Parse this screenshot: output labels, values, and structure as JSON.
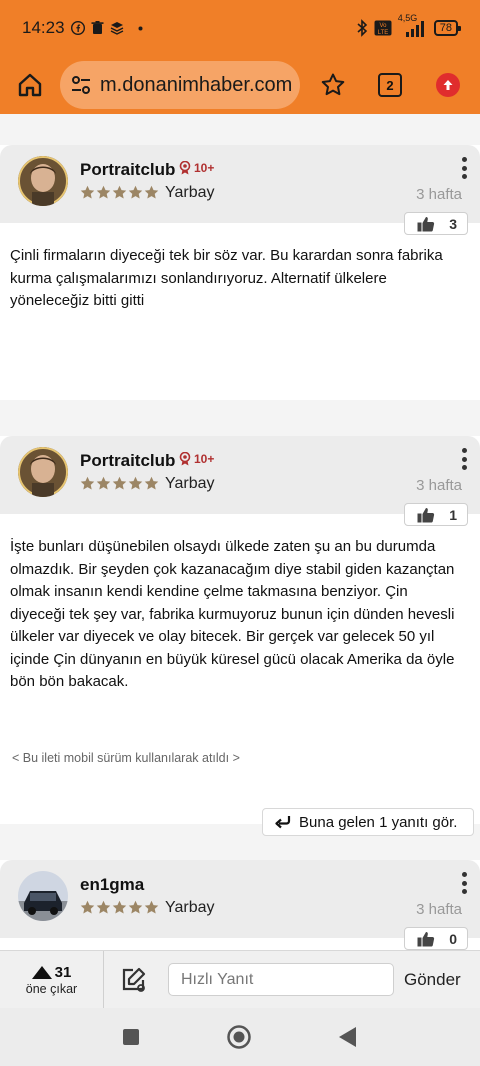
{
  "status": {
    "time": "14:23",
    "battery": "78",
    "network": "4,5G",
    "volte": "Vo LTE"
  },
  "browser": {
    "url": "m.donanimhaber.com",
    "tab_count": "2"
  },
  "posts": [
    {
      "username": "Portraitclub",
      "badge": "10+",
      "rank": "Yarbay",
      "rating_stars": 5,
      "time": "3 hafta",
      "likes": "3",
      "text": "Çinli firmaların diyeceği tek bir söz var. Bu karardan sonra fabrika kurma çalışmalarımızı sonlandırıyoruz. Alternatif ülkelere yöneleceğiz bitti gitti"
    },
    {
      "username": "Portraitclub",
      "badge": "10+",
      "rank": "Yarbay",
      "rating_stars": 5,
      "time": "3 hafta",
      "likes": "1",
      "text": "İşte bunları düşünebilen olsaydı ülkede zaten şu an bu durumda olmazdık. Bir şeyden çok kazanacağım diye stabil giden kazançtan olmak insanın kendi kendine çelme takmasına benziyor. Çin diyeceği tek şey var, fabrika kurmuyoruz bunun için dünden hevesli ülkeler var diyecek ve olay bitecek. Bir gerçek var gelecek 50 yıl içinde Çin dünyanın en büyük küresel gücü olacak Amerika da öyle bön bön bakacak.",
      "mobile_note": "< Bu ileti mobil sürüm kullanılarak atıldı >",
      "replies_label": "Buna gelen 1 yanıtı gör."
    },
    {
      "username": "en1gma",
      "rank": "Yarbay",
      "rating_stars": 5,
      "time": "3 hafta",
      "likes": "0"
    }
  ],
  "toolbar": {
    "upvote_count": "31",
    "upvote_label": "öne çıkar",
    "reply_placeholder": "Hızlı Yanıt",
    "send_label": "Gönder"
  },
  "icons": {
    "home": "home-icon",
    "site_settings": "tune-icon",
    "bookmark": "star-icon",
    "update": "update-icon",
    "like": "thumbs-up-icon",
    "reply": "reply-arrow-icon",
    "edit": "edit-icon",
    "more": "more-vert-icon"
  },
  "colors": {
    "brand_orange": "#f07f28",
    "badge_red": "#b03030",
    "star_gold": "#9c8665"
  }
}
